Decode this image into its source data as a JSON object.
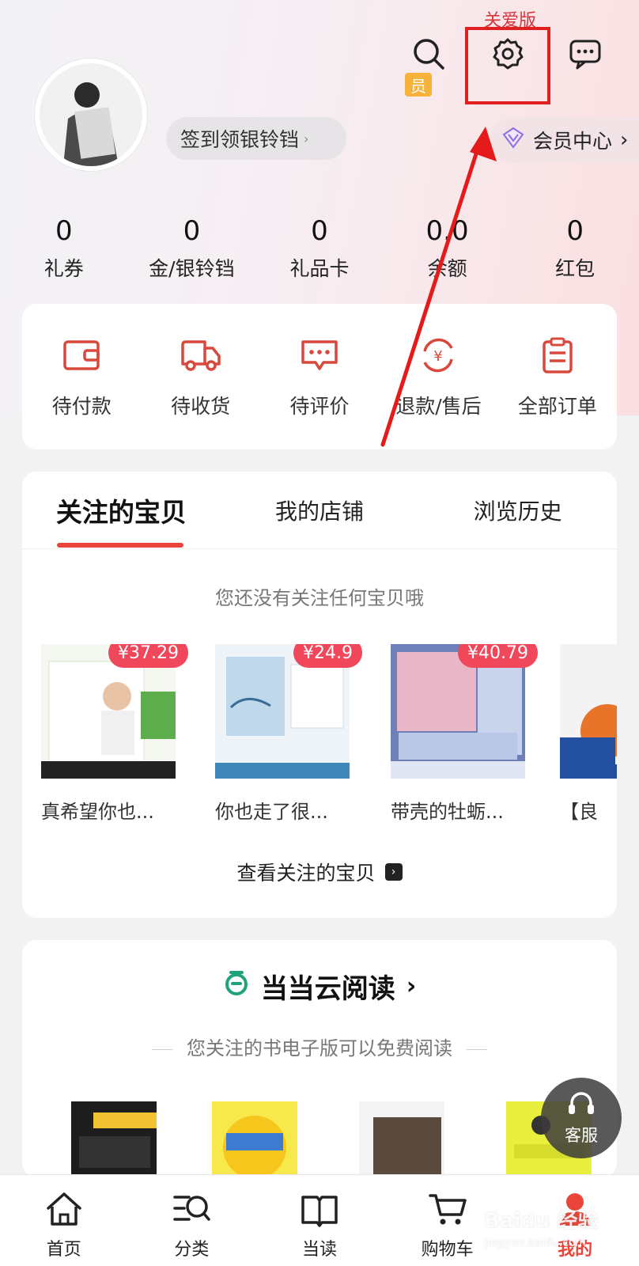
{
  "header": {
    "care_label": "关爱版",
    "vip_tag": "员",
    "signin_label": "签到领银铃铛",
    "member_center_label": "会员中心"
  },
  "stats": [
    {
      "value": "0",
      "label": "礼券"
    },
    {
      "value": "0",
      "label": "金/银铃铛"
    },
    {
      "value": "0",
      "label": "礼品卡"
    },
    {
      "value": "0.0",
      "label": "余额"
    },
    {
      "value": "0",
      "label": "红包"
    }
  ],
  "orders": [
    {
      "label": "待付款",
      "icon": "wallet-icon"
    },
    {
      "label": "待收货",
      "icon": "truck-icon"
    },
    {
      "label": "待评价",
      "icon": "comment-icon"
    },
    {
      "label": "退款/售后",
      "icon": "refund-icon"
    },
    {
      "label": "全部订单",
      "icon": "clipboard-icon"
    }
  ],
  "favorites": {
    "tabs": [
      "关注的宝贝",
      "我的店铺",
      "浏览历史"
    ],
    "empty_text": "您还没有关注任何宝贝哦",
    "products": [
      {
        "price": "¥37.29",
        "name": "真希望你也..."
      },
      {
        "price": "¥24.9",
        "name": "你也走了很..."
      },
      {
        "price": "¥40.79",
        "name": "带壳的牡蛎..."
      },
      {
        "price": "",
        "name": "【良"
      }
    ],
    "view_all": "查看关注的宝贝"
  },
  "cloud_read": {
    "title": "当当云阅读",
    "subtitle": "您关注的书电子版可以免费阅读"
  },
  "service_label": "客服",
  "tabbar": [
    {
      "label": "首页",
      "icon": "home-icon"
    },
    {
      "label": "分类",
      "icon": "category-icon"
    },
    {
      "label": "当读",
      "icon": "book-icon"
    },
    {
      "label": "购物车",
      "icon": "cart-icon"
    },
    {
      "label": "我的",
      "icon": "profile-icon"
    }
  ],
  "colors": {
    "accent": "#e9453b",
    "price_badge": "#f0475b",
    "annotation": "#e02020"
  }
}
